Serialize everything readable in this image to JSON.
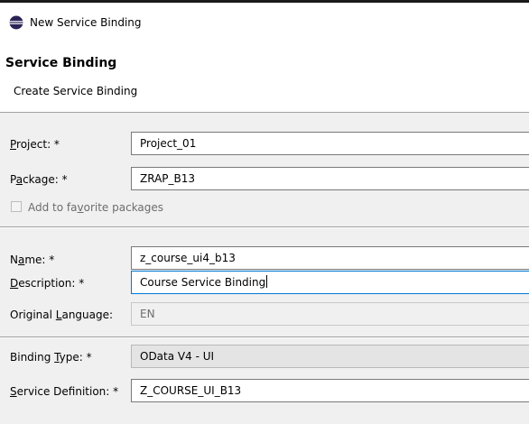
{
  "window": {
    "title": "New Service Binding",
    "icon": "eclipse-icon"
  },
  "header": {
    "title": "Service Binding",
    "subtitle": "Create Service Binding"
  },
  "form": {
    "project": {
      "label": "Project: *",
      "value": "Project_01"
    },
    "package": {
      "label": "Package: *",
      "value": "ZRAP_B13"
    },
    "favorite": {
      "label": "Add to favorite packages",
      "checked": false,
      "enabled": false
    },
    "name": {
      "label": "Name: *",
      "value": "z_course_ui4_b13"
    },
    "description": {
      "label": "Description: *",
      "value": "Course Service Binding"
    },
    "original_language": {
      "label": "Original Language:",
      "value": "EN"
    },
    "binding_type": {
      "label": "Binding Type: *",
      "value": "OData V4 - UI"
    },
    "service_definition": {
      "label": "Service Definition: *",
      "value": "Z_COURSE_UI_B13"
    }
  }
}
